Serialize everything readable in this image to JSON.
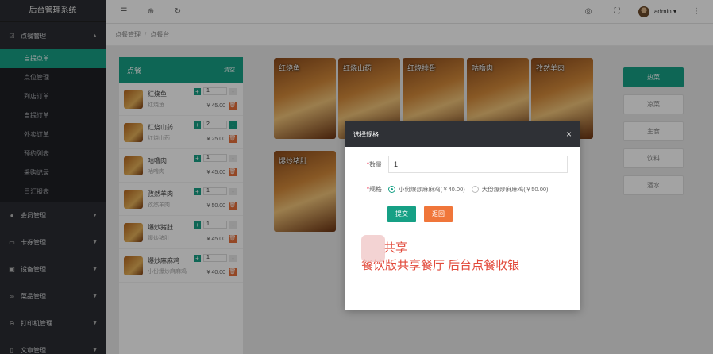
{
  "app": {
    "title": "后台管理系统"
  },
  "sidebar": {
    "groups": [
      {
        "label": "点餐管理",
        "icon": "checkbox-icon",
        "expanded": true
      },
      {
        "label": "会员管理",
        "icon": "user-icon"
      },
      {
        "label": "卡券管理",
        "icon": "card-icon"
      },
      {
        "label": "设备管理",
        "icon": "device-icon"
      },
      {
        "label": "菜品管理",
        "icon": "dish-icon"
      },
      {
        "label": "打印机管理",
        "icon": "printer-icon"
      },
      {
        "label": "文章管理",
        "icon": "article-icon"
      }
    ],
    "subitems": [
      "自提点单",
      "点位管理",
      "到店订单",
      "自提订单",
      "外卖订单",
      "预约列表",
      "采购记录",
      "日汇报表"
    ],
    "active_subitem": 0
  },
  "topbar": {
    "user": "admin ▾"
  },
  "breadcrumb": [
    "点餐管理",
    "点餐台"
  ],
  "order": {
    "title": "点餐",
    "clear_label": "清空",
    "items": [
      {
        "name": "红烧鱼",
        "spec": "红烧鱼",
        "qty": "1",
        "price": "¥ 45.00"
      },
      {
        "name": "红烧山药",
        "spec": "红烧山药",
        "qty": "2",
        "price": "¥ 25.00"
      },
      {
        "name": "咕噜肉",
        "spec": "咕噜肉",
        "qty": "1",
        "price": "¥ 45.00"
      },
      {
        "name": "孜然羊肉",
        "spec": "孜然羊肉",
        "qty": "1",
        "price": "¥ 50.00"
      },
      {
        "name": "爆炒猪肚",
        "spec": "爆炒猪肚",
        "qty": "1",
        "price": "¥ 45.00"
      },
      {
        "name": "爆炒麻麻鸡",
        "spec": "小份爆炒麻麻鸡",
        "qty": "1",
        "price": "¥ 40.00"
      }
    ]
  },
  "dishes": [
    "红烧鱼",
    "红烧山药",
    "红烧排骨",
    "咕噜肉",
    "孜然羊肉",
    "爆炒猪肚"
  ],
  "categories": [
    "热菜",
    "凉菜",
    "主食",
    "饮料",
    "酒水"
  ],
  "modal": {
    "title": "选择规格",
    "qty_label": "数量",
    "qty_value": "1",
    "spec_label": "规格",
    "options": [
      "小份爆炒麻麻鸡(￥40.00)",
      "大份爆炒麻麻鸡(￥50.00)"
    ],
    "selected": 0,
    "submit": "提交",
    "back": "返回"
  },
  "promo": {
    "line1": "共享",
    "line2": "餐饮版共享餐厅   后台点餐收银"
  },
  "colors": {
    "primary": "#16a085",
    "danger": "#f0763a",
    "sidebar": "#2b2d32"
  }
}
